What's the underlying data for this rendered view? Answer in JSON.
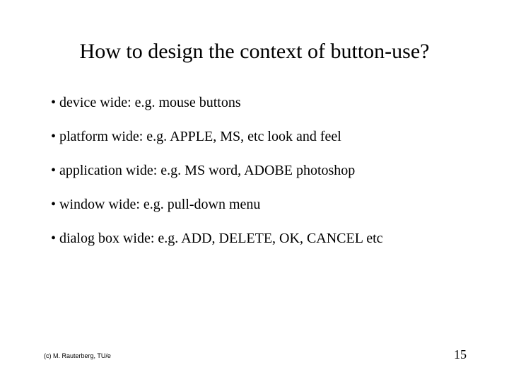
{
  "title": "How to design the context of button-use?",
  "bullets": [
    "• device wide: e.g. mouse buttons",
    "• platform wide: e.g. APPLE, MS, etc look and feel",
    "• application wide: e.g. MS word, ADOBE photoshop",
    "• window wide: e.g. pull-down menu",
    "• dialog box wide: e.g. ADD, DELETE, OK, CANCEL  etc"
  ],
  "footer": {
    "copyright": "(c) M. Rauterberg, TU/e",
    "page_number": "15"
  }
}
